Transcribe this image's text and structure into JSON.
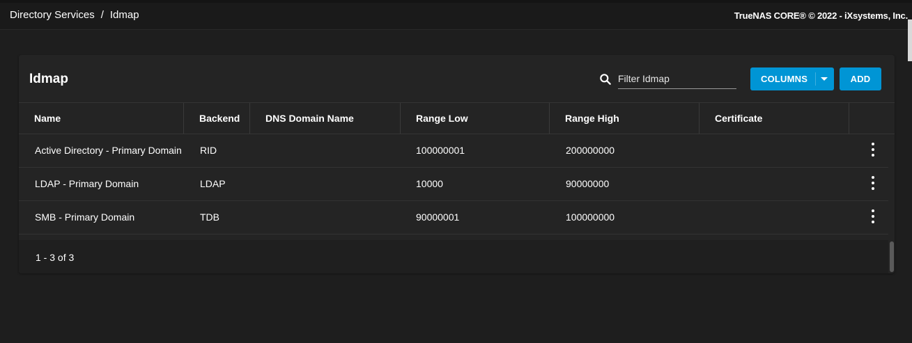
{
  "breadcrumb": {
    "parent": "Directory Services",
    "separator": "/",
    "current": "Idmap"
  },
  "copyright": "TrueNAS CORE® © 2022 - iXsystems, Inc.",
  "card": {
    "title": "Idmap",
    "filter_placeholder": "Filter Idmap",
    "columns_button": "COLUMNS",
    "add_button": "ADD"
  },
  "table": {
    "columns": [
      "Name",
      "Backend",
      "DNS Domain Name",
      "Range Low",
      "Range High",
      "Certificate"
    ],
    "rows": [
      {
        "name": "Active Directory - Primary Domain",
        "backend": "RID",
        "dns": "",
        "range_low": "100000001",
        "range_high": "200000000",
        "certificate": ""
      },
      {
        "name": "LDAP - Primary Domain",
        "backend": "LDAP",
        "dns": "",
        "range_low": "10000",
        "range_high": "90000000",
        "certificate": ""
      },
      {
        "name": "SMB - Primary Domain",
        "backend": "TDB",
        "dns": "",
        "range_low": "90000001",
        "range_high": "100000000",
        "certificate": ""
      }
    ]
  },
  "pager": {
    "range": "1 - 3 of 3"
  },
  "icons": {
    "search": "search-icon",
    "row_menu": "more-vert-icon",
    "dropdown": "caret-down-icon"
  },
  "colors": {
    "background": "#1e1e1e",
    "card": "#242424",
    "accent": "#0095d5",
    "text": "#ffffff"
  }
}
